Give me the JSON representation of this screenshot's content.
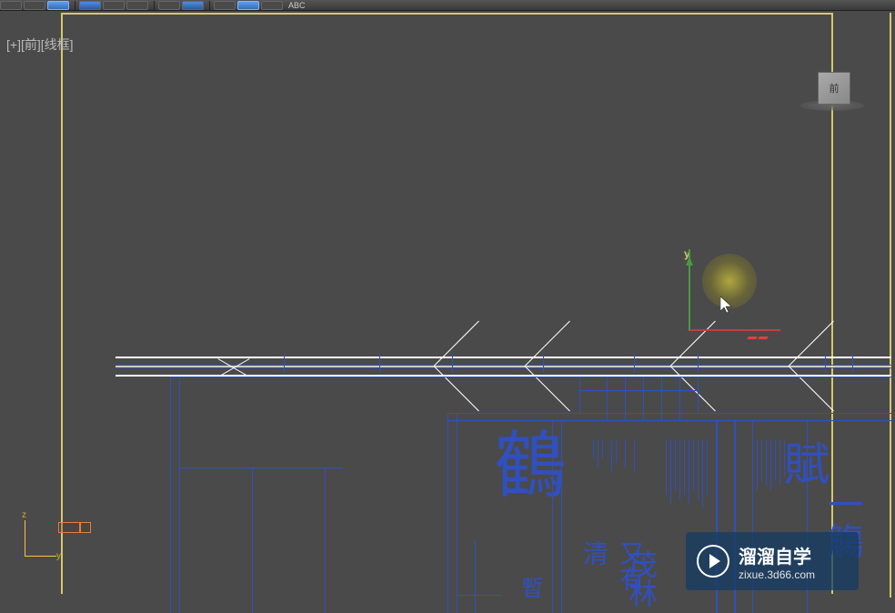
{
  "view": {
    "label": "[+][前][线框]",
    "cube_face": "前"
  },
  "gizmo": {
    "axis_y": "y",
    "axis_z": "z",
    "axis_y2": "y"
  },
  "toolbar": {
    "abc": "ABC"
  },
  "watermark": {
    "title": "溜溜自学",
    "url": "zixue.3d66.com"
  },
  "drawing": {
    "char1": "鶴",
    "char2": "又有清",
    "char3": "茂林",
    "char4": "一觴",
    "char5": "賦",
    "char6": "暫"
  }
}
